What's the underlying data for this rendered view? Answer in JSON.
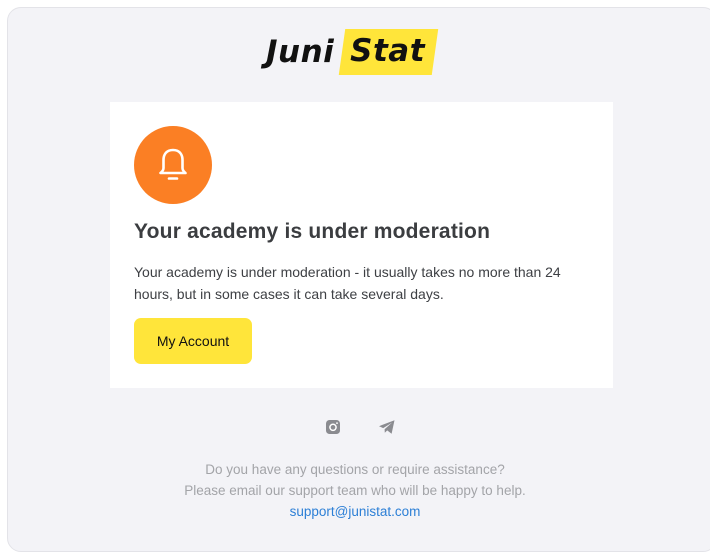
{
  "logo": {
    "part1": "Juni",
    "part2": "Stat"
  },
  "colors": {
    "accent_yellow": "#ffe53a",
    "bell_orange": "#fb7f24",
    "link_blue": "#2c7fd6",
    "background": "#f3f3f7"
  },
  "card": {
    "icon": "bell-icon",
    "title": "Your academy is under moderation",
    "body_line1": "Your academy is under moderation - it usually takes no more than 24",
    "body_line2": "hours, but in some cases it can take several days.",
    "button_label": "My Account"
  },
  "socials": [
    {
      "icon": "instagram-icon"
    },
    {
      "icon": "telegram-icon"
    }
  ],
  "footer": {
    "line1": "Do you have any questions or require assistance?",
    "line2": "Please email our support team who will be happy to help.",
    "email": "support@junistat.com"
  }
}
